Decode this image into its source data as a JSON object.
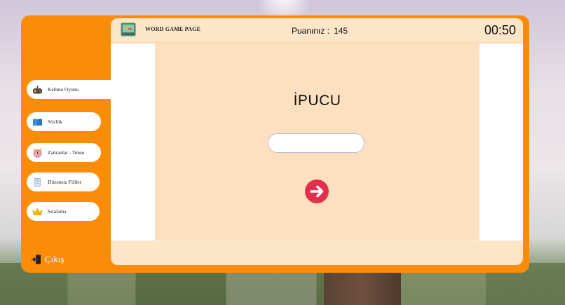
{
  "header": {
    "page_title": "WORD GAME PAGE",
    "score_label": "Puanınız :",
    "score_value": "145",
    "timer": "00:50"
  },
  "sidebar": {
    "items": [
      {
        "label": "Kelime Oyunu",
        "icon": "gamepad-icon",
        "active": true
      },
      {
        "label": "Sözlük",
        "icon": "book-icon",
        "active": false
      },
      {
        "label": "Zamanlar - Tense",
        "icon": "clock-icon",
        "active": false
      },
      {
        "label": "Düzensiz Fiiller",
        "icon": "notepad-icon",
        "active": false
      },
      {
        "label": "Sıralama",
        "icon": "crown-icon",
        "active": false
      }
    ],
    "exit_label": "Çıkış"
  },
  "game": {
    "hint": "İPUCU",
    "answer_value": "",
    "next_icon": "arrow-right-icon"
  },
  "colors": {
    "accent": "#fb8c08",
    "panel": "#fde0bf",
    "next_button": "#e0304b"
  }
}
